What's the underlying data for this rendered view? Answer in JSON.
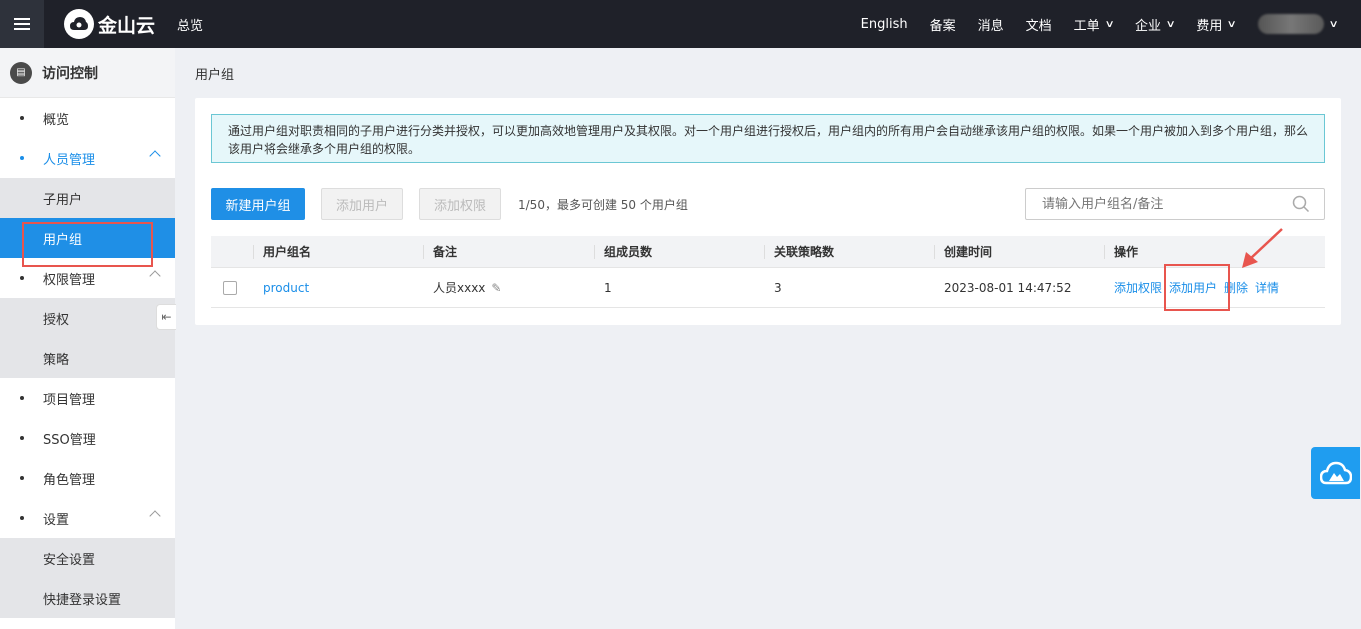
{
  "topbar": {
    "brand": "金山云",
    "overview": "总览",
    "right_items": [
      {
        "label": "English",
        "dropdown": false
      },
      {
        "label": "备案",
        "dropdown": false
      },
      {
        "label": "消息",
        "dropdown": false
      },
      {
        "label": "文档",
        "dropdown": false
      },
      {
        "label": "工单",
        "dropdown": true
      },
      {
        "label": "企业",
        "dropdown": true
      },
      {
        "label": "费用",
        "dropdown": true
      }
    ]
  },
  "sidebar": {
    "title": "访问控制",
    "items": {
      "overview": "概览",
      "people": "人员管理",
      "subuser": "子用户",
      "usergroup": "用户组",
      "permission": "权限管理",
      "grant": "授权",
      "policy": "策略",
      "project": "项目管理",
      "sso": "SSO管理",
      "role": "角色管理",
      "settings": "设置",
      "security": "安全设置",
      "quicklogin": "快捷登录设置"
    }
  },
  "main": {
    "breadcrumb": "用户组",
    "notice_line1": "通过用户组对职责相同的子用户进行分类并授权，可以更加高效地管理用户及其权限。对一个用户组进行授权后，用户组内的所有用户会自动继承该用户组的权限。如果一个用户被加入到多个用户组，那么",
    "notice_line2": "该用户将会继承多个用户组的权限。",
    "buttons": {
      "create": "新建用户组",
      "add_user": "添加用户",
      "add_permission": "添加权限"
    },
    "quota": "1/50，最多可创建 50 个用户组",
    "search_placeholder": "请输入用户组名/备注",
    "table": {
      "headers": [
        "用户组名",
        "备注",
        "组成员数",
        "关联策略数",
        "创建时间",
        "操作"
      ],
      "rows": [
        {
          "name": "product",
          "remark": "人员xxxx",
          "members": "1",
          "policies": "3",
          "created": "2023-08-01 14:47:52",
          "actions": [
            "添加权限",
            "添加用户",
            "删除",
            "详情"
          ]
        }
      ]
    }
  },
  "colors": {
    "accent": "#1f8fe6",
    "topbar": "#1f2129",
    "highlight": "#e8554e"
  }
}
